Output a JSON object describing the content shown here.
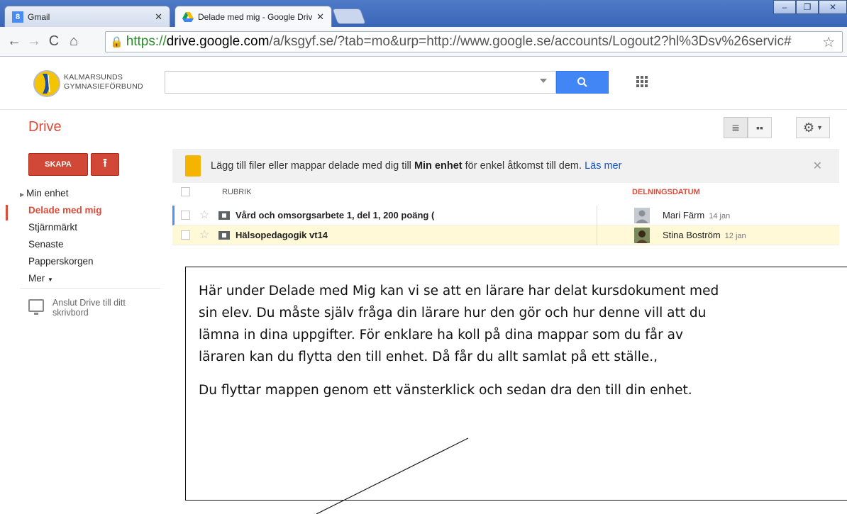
{
  "browser": {
    "tabs": [
      {
        "label": "Gmail",
        "active": false,
        "icon": "gmail-icon"
      },
      {
        "label": "Delade med mig - Google Driv",
        "active": true,
        "icon": "drive-icon"
      }
    ],
    "url": {
      "scheme": "https://",
      "host": "drive.google.com",
      "rest": "/a/ksgyf.se/?tab=mo&urp=http://www.google.se/accounts/Logout2?hl%3Dsv%26servic#"
    }
  },
  "org": {
    "line1": "KALMARSUNDS",
    "line2": "GYMNASIEFÖRBUND"
  },
  "search": {
    "placeholder": ""
  },
  "app_title": "Drive",
  "sidebar": {
    "create_label": "SKAPA",
    "items": [
      {
        "label": "Min enhet"
      },
      {
        "label": "Delade med mig",
        "active": true
      },
      {
        "label": "Stjärnmärkt"
      },
      {
        "label": "Senaste"
      },
      {
        "label": "Papperskorgen"
      },
      {
        "label": "Mer"
      }
    ],
    "desktop_line1": "Anslut Drive till ditt",
    "desktop_line2": "skrivbord"
  },
  "banner": {
    "text_before": "Lägg till filer eller mappar delade med dig till ",
    "bold": "Min enhet",
    "text_after": " för enkel åtkomst till dem. ",
    "link": "Läs mer"
  },
  "table": {
    "headers": {
      "title": "RUBRIK",
      "shared_date": "DELNINGSDATUM"
    },
    "rows": [
      {
        "title": "Vård och omsorgsarbete 1, del 1, 200 poäng (",
        "owner": "Mari Färm",
        "date": "14 jan"
      },
      {
        "title": "Hälsopedagogik vt14",
        "owner": "Stina Boström",
        "date": "12 jan"
      }
    ]
  },
  "callout": {
    "lines": [
      "Här under Delade med Mig kan vi se att en lärare har delat kursdokument med",
      "sin elev.  Du måste själv fråga din lärare hur den gör och hur denne vill att du",
      "lämna in dina uppgifter. För enklare ha koll på dina mappar som du får av",
      "läraren kan du flytta den till enhet. Då får du allt samlat på ett ställe.,"
    ],
    "second": "Du flyttar mappen genom ett vänsterklick och sedan dra den till din enhet."
  },
  "colors": {
    "accent": "#dd4b39",
    "search": "#4285f4",
    "banner_icon": "#f5b400",
    "selected_row": "#fff9d7"
  }
}
